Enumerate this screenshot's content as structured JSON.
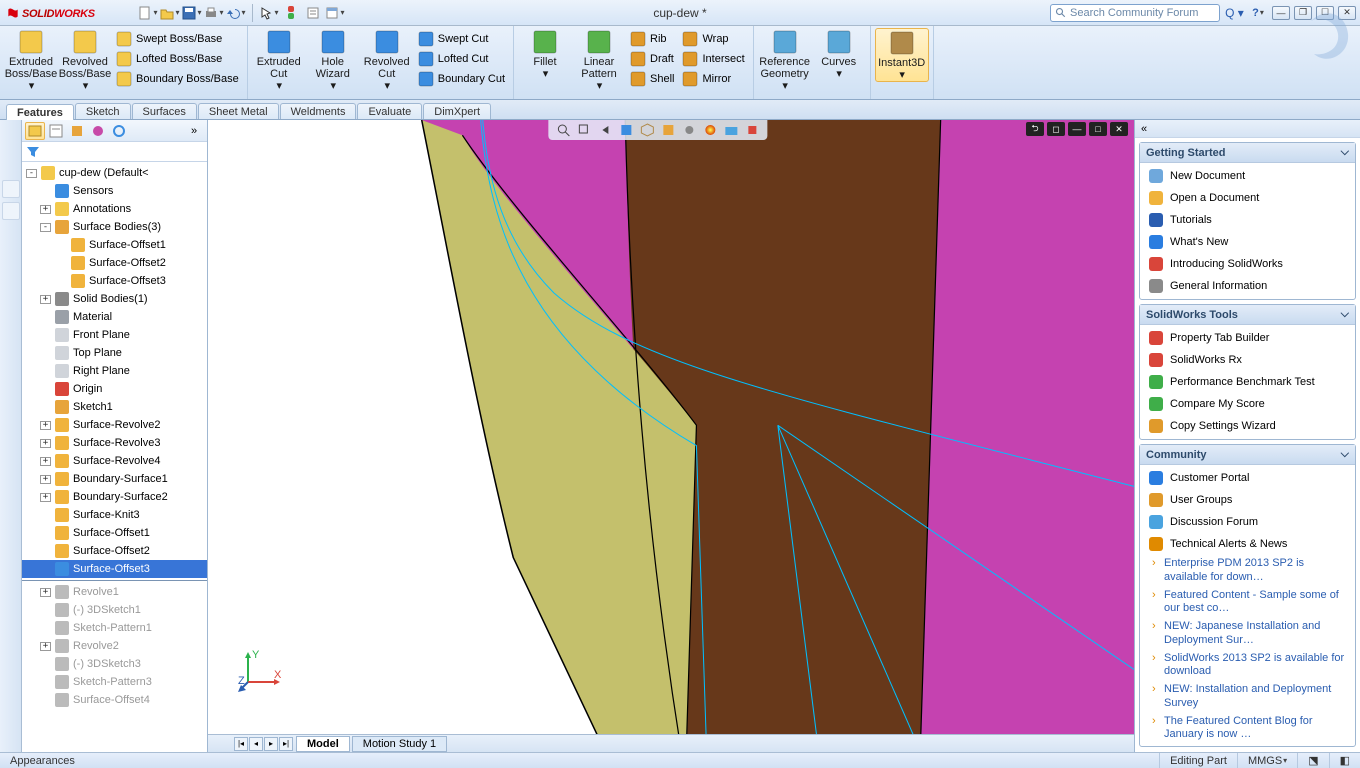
{
  "app": {
    "title": "cup-dew *",
    "search_placeholder": "Search Community Forum",
    "logo_solid": "SOLID",
    "logo_works": "WORKS"
  },
  "ribbon": {
    "groups": [
      {
        "big": [
          {
            "label": "Extruded",
            "sub": "Boss/Base",
            "color": "#f3c94b"
          },
          {
            "label": "Revolved",
            "sub": "Boss/Base",
            "color": "#f3c94b"
          }
        ],
        "small": [
          {
            "label": "Swept Boss/Base",
            "color": "#f3c94b"
          },
          {
            "label": "Lofted Boss/Base",
            "color": "#f3c94b"
          },
          {
            "label": "Boundary Boss/Base",
            "color": "#f3c94b"
          }
        ]
      },
      {
        "big": [
          {
            "label": "Extruded",
            "sub": "Cut",
            "color": "#3b8de0"
          },
          {
            "label": "Hole",
            "sub": "Wizard",
            "color": "#3b8de0"
          },
          {
            "label": "Revolved",
            "sub": "Cut",
            "color": "#3b8de0"
          }
        ],
        "small": [
          {
            "label": "Swept Cut",
            "color": "#3b8de0"
          },
          {
            "label": "Lofted Cut",
            "color": "#3b8de0"
          },
          {
            "label": "Boundary Cut",
            "color": "#3b8de0"
          }
        ]
      },
      {
        "big": [
          {
            "label": "Fillet",
            "sub": "",
            "color": "#58b24c"
          },
          {
            "label": "Linear",
            "sub": "Pattern",
            "color": "#58b24c"
          }
        ],
        "small": [
          {
            "label": "Rib",
            "color": "#e09a2b"
          },
          {
            "label": "Draft",
            "color": "#e09a2b"
          },
          {
            "label": "Shell",
            "color": "#e09a2b"
          }
        ],
        "small2": [
          {
            "label": "Wrap",
            "color": "#e09a2b"
          },
          {
            "label": "Intersect",
            "color": "#e09a2b"
          },
          {
            "label": "Mirror",
            "color": "#e09a2b"
          }
        ]
      },
      {
        "big": [
          {
            "label": "Reference",
            "sub": "Geometry",
            "color": "#5aa8d8"
          },
          {
            "label": "Curves",
            "sub": "",
            "color": "#5aa8d8"
          }
        ],
        "small": []
      },
      {
        "big": [
          {
            "label": "Instant3D",
            "sub": "",
            "color": "#b08a4a",
            "hl": true
          }
        ],
        "small": []
      }
    ],
    "tabs": [
      "Features",
      "Sketch",
      "Surfaces",
      "Sheet Metal",
      "Weldments",
      "Evaluate",
      "DimXpert"
    ],
    "active_tab": "Features"
  },
  "tree": {
    "root": "cup-dew  (Default<<Defa",
    "items": [
      {
        "d": 1,
        "exp": "",
        "ic": "#3b8de0",
        "t": "Sensors"
      },
      {
        "d": 1,
        "exp": "+",
        "ic": "#f3c94b",
        "t": "Annotations"
      },
      {
        "d": 1,
        "exp": "-",
        "ic": "#e7a43b",
        "t": "Surface Bodies(3)"
      },
      {
        "d": 2,
        "exp": "",
        "ic": "#f0b33c",
        "t": "Surface-Offset1"
      },
      {
        "d": 2,
        "exp": "",
        "ic": "#f0b33c",
        "t": "Surface-Offset2"
      },
      {
        "d": 2,
        "exp": "",
        "ic": "#f0b33c",
        "t": "Surface-Offset3"
      },
      {
        "d": 1,
        "exp": "+",
        "ic": "#8a8a8a",
        "t": "Solid Bodies(1)"
      },
      {
        "d": 1,
        "exp": "",
        "ic": "#9aa0a8",
        "t": "Material <not specified"
      },
      {
        "d": 1,
        "exp": "",
        "ic": "#d0d4da",
        "t": "Front Plane"
      },
      {
        "d": 1,
        "exp": "",
        "ic": "#d0d4da",
        "t": "Top Plane"
      },
      {
        "d": 1,
        "exp": "",
        "ic": "#d0d4da",
        "t": "Right Plane"
      },
      {
        "d": 1,
        "exp": "",
        "ic": "#d9453a",
        "t": "Origin"
      },
      {
        "d": 1,
        "exp": "",
        "ic": "#e7a43b",
        "t": "Sketch1"
      },
      {
        "d": 1,
        "exp": "+",
        "ic": "#f0b33c",
        "t": "Surface-Revolve2"
      },
      {
        "d": 1,
        "exp": "+",
        "ic": "#f0b33c",
        "t": "Surface-Revolve3"
      },
      {
        "d": 1,
        "exp": "+",
        "ic": "#f0b33c",
        "t": "Surface-Revolve4"
      },
      {
        "d": 1,
        "exp": "+",
        "ic": "#f0b33c",
        "t": "Boundary-Surface1"
      },
      {
        "d": 1,
        "exp": "+",
        "ic": "#f0b33c",
        "t": "Boundary-Surface2"
      },
      {
        "d": 1,
        "exp": "",
        "ic": "#f0b33c",
        "t": "Surface-Knit3"
      },
      {
        "d": 1,
        "exp": "",
        "ic": "#f0b33c",
        "t": "Surface-Offset1"
      },
      {
        "d": 1,
        "exp": "",
        "ic": "#f0b33c",
        "t": "Surface-Offset2"
      },
      {
        "d": 1,
        "exp": "",
        "ic": "#3b8de0",
        "t": "Surface-Offset3",
        "sel": true
      }
    ],
    "dim": [
      {
        "d": 1,
        "exp": "+",
        "t": "Revolve1"
      },
      {
        "d": 1,
        "exp": "",
        "t": "(-) 3DSketch1"
      },
      {
        "d": 1,
        "exp": "",
        "t": "Sketch-Pattern1"
      },
      {
        "d": 1,
        "exp": "+",
        "t": "Revolve2"
      },
      {
        "d": 1,
        "exp": "",
        "t": "(-) 3DSketch3"
      },
      {
        "d": 1,
        "exp": "",
        "t": "Sketch-Pattern3"
      },
      {
        "d": 1,
        "exp": "",
        "t": "Surface-Offset4"
      }
    ]
  },
  "bottom_tabs": {
    "tabs": [
      "Model",
      "Motion Study 1"
    ],
    "active": "Model"
  },
  "taskpane": {
    "sections": [
      {
        "title": "Getting Started",
        "items": [
          {
            "ic": "#6fa8dc",
            "t": "New Document"
          },
          {
            "ic": "#f0b33c",
            "t": "Open a Document"
          },
          {
            "ic": "#2a5db0",
            "t": "Tutorials"
          },
          {
            "ic": "#2a7de0",
            "t": "What's New"
          },
          {
            "ic": "#d9453a",
            "t": "Introducing SolidWorks"
          },
          {
            "ic": "#8a8a8a",
            "t": "General Information"
          }
        ]
      },
      {
        "title": "SolidWorks Tools",
        "items": [
          {
            "ic": "#d9453a",
            "t": "Property Tab Builder"
          },
          {
            "ic": "#d9453a",
            "t": "SolidWorks Rx"
          },
          {
            "ic": "#3fae49",
            "t": "Performance Benchmark Test"
          },
          {
            "ic": "#3fae49",
            "t": "Compare My Score"
          },
          {
            "ic": "#e09a2b",
            "t": "Copy Settings Wizard"
          }
        ]
      },
      {
        "title": "Community",
        "items": [
          {
            "ic": "#2a7de0",
            "t": "Customer Portal"
          },
          {
            "ic": "#e09a2b",
            "t": "User Groups"
          },
          {
            "ic": "#4aa3df",
            "t": "Discussion Forum"
          },
          {
            "ic": "#e08a00",
            "t": "Technical Alerts & News"
          }
        ],
        "subs": [
          "Enterprise PDM 2013 SP2 is available for down…",
          "Featured Content - Sample some of our best co…",
          "NEW: Japanese Installation and Deployment Sur…",
          "SolidWorks 2013 SP2 is available for download",
          "NEW: Installation and Deployment Survey",
          "The Featured Content Blog for January is now …"
        ]
      }
    ]
  },
  "status": {
    "left": "Appearances",
    "mode": "Editing Part",
    "units": "MMGS"
  },
  "triad": {
    "x": "X",
    "y": "Y",
    "z": "Z"
  }
}
